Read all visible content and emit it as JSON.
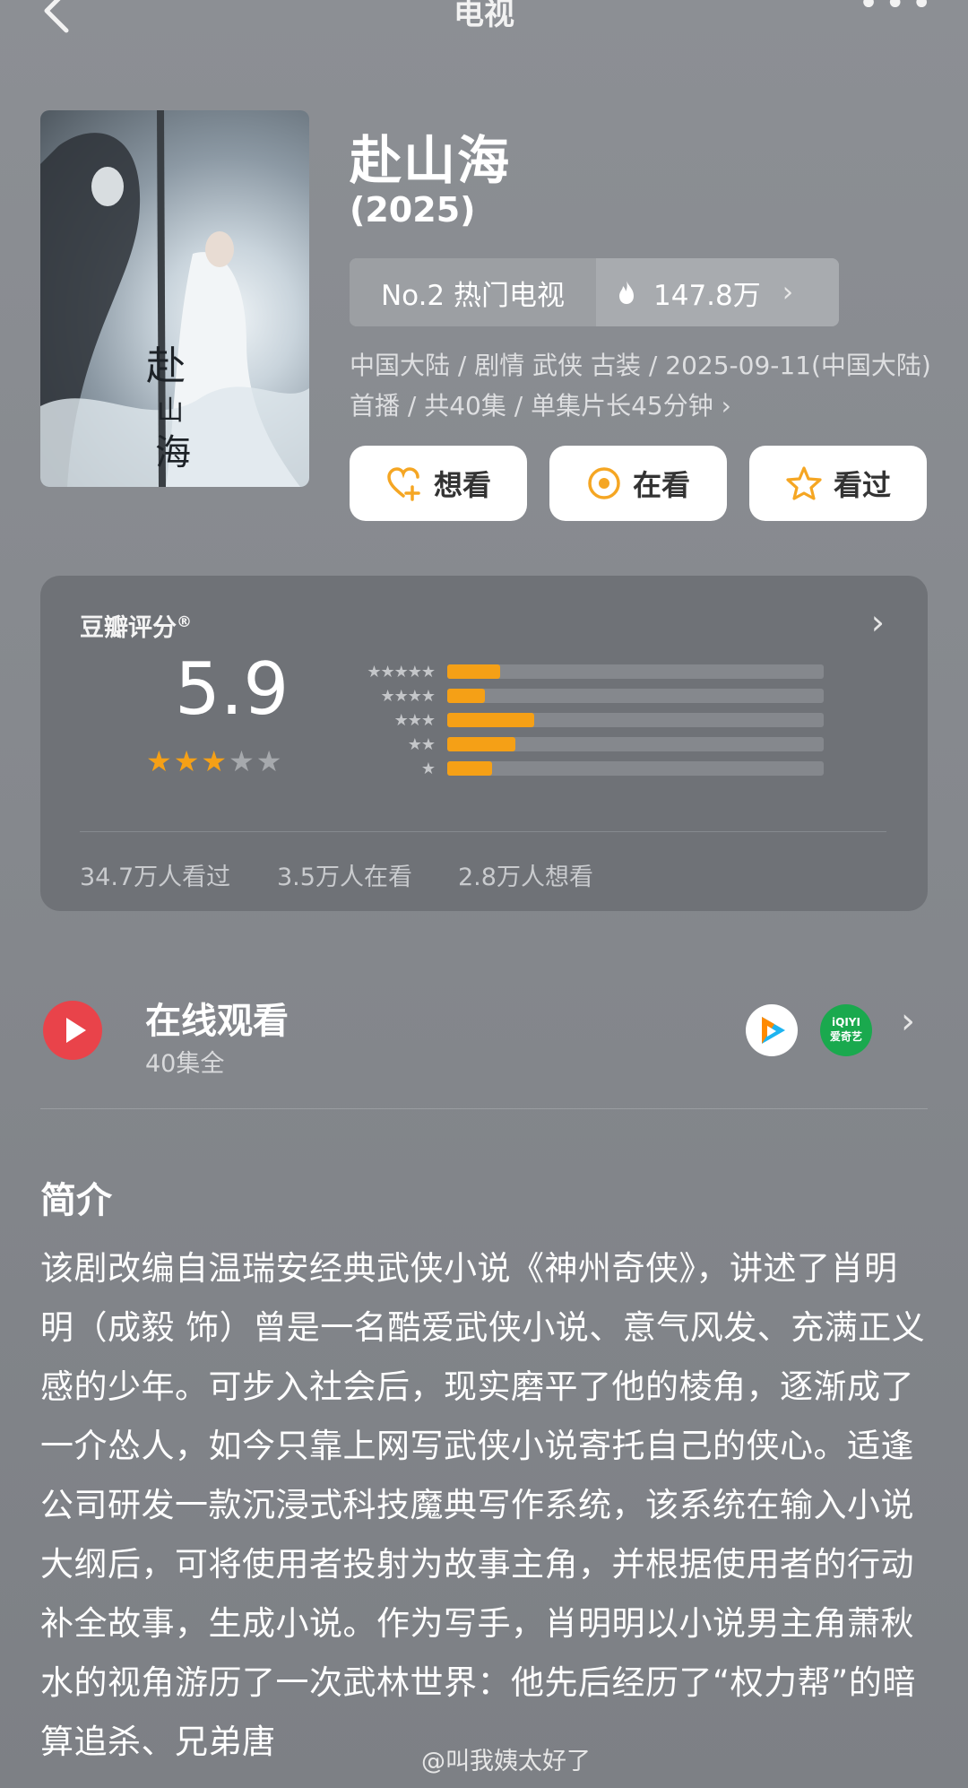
{
  "header": {
    "title": "电视",
    "more": "•••"
  },
  "movie": {
    "title": "赴山海",
    "year": "(2025)",
    "rank_label": "No.2 热门电视",
    "heat": "147.8万",
    "meta": "中国大陆 / 剧情 武侠 古装 / 2025-09-11(中国大陆)首播 / 共40集 / 单集片长45分钟 ›"
  },
  "actions": [
    {
      "label": "想看",
      "icon": "heart-plus-icon",
      "color": "#f5a623"
    },
    {
      "label": "在看",
      "icon": "target-icon",
      "color": "#f5a623"
    },
    {
      "label": "看过",
      "icon": "star-outline-icon",
      "color": "#f5a623"
    }
  ],
  "rating": {
    "label": "豆瓣评分",
    "score": "5.9",
    "stars_filled": 3,
    "stars_total": 5,
    "distribution_fraction": [
      0.14,
      0.1,
      0.23,
      0.18,
      0.12
    ],
    "stats": [
      "34.7万人看过",
      "3.5万人在看",
      "2.8万人想看"
    ],
    "accent": "#f5a016"
  },
  "online": {
    "title": "在线观看",
    "subtitle": "40集全",
    "providers": [
      "腾讯视频",
      "iQIYI 爱奇艺"
    ]
  },
  "intro": {
    "title": "简介",
    "text": "该剧改编自温瑞安经典武侠小说《神州奇侠》，讲述了肖明明（成毅 饰）曾是一名酷爱武侠小说、意气风发、充满正义感的少年。可步入社会后，现实磨平了他的棱角，逐渐成了一介怂人，如今只靠上网写武侠小说寄托自己的侠心。适逢公司研发一款沉浸式科技魔典写作系统，该系统在输入小说大纲后，可将使用者投射为故事主角，并根据使用者的行动补全故事，生成小说。作为写手，肖明明以小说男主角萧秋水的视角游历了一次武林世界：他先后经历了“权力帮”的暗算追杀、兄弟唐"
  },
  "watermark": "@叫我姨太好了"
}
